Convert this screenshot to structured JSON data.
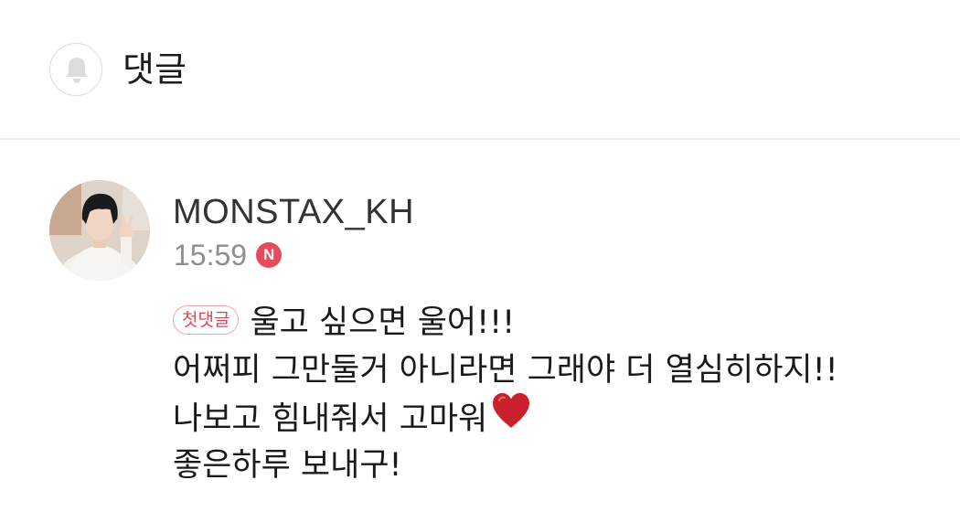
{
  "header": {
    "icon": "bell-icon",
    "title": "댓글"
  },
  "comment": {
    "author": "MONSTAX_KH",
    "time": "15:59",
    "new_badge": "N",
    "first_comment_badge": "첫댓글",
    "lines": [
      "울고 싶으면 울어!!!",
      "어쩌피 그만둘거 아니라면 그래야 더 열심히하지!!",
      "나보고 힘내줘서 고마워",
      "좋은하루 보내구!"
    ],
    "emoji": "red-heart-icon"
  },
  "colors": {
    "badge_red": "#e84a5a",
    "first_badge_text": "#e04452",
    "first_badge_border": "#f3a6ae",
    "divider": "#ececec"
  }
}
